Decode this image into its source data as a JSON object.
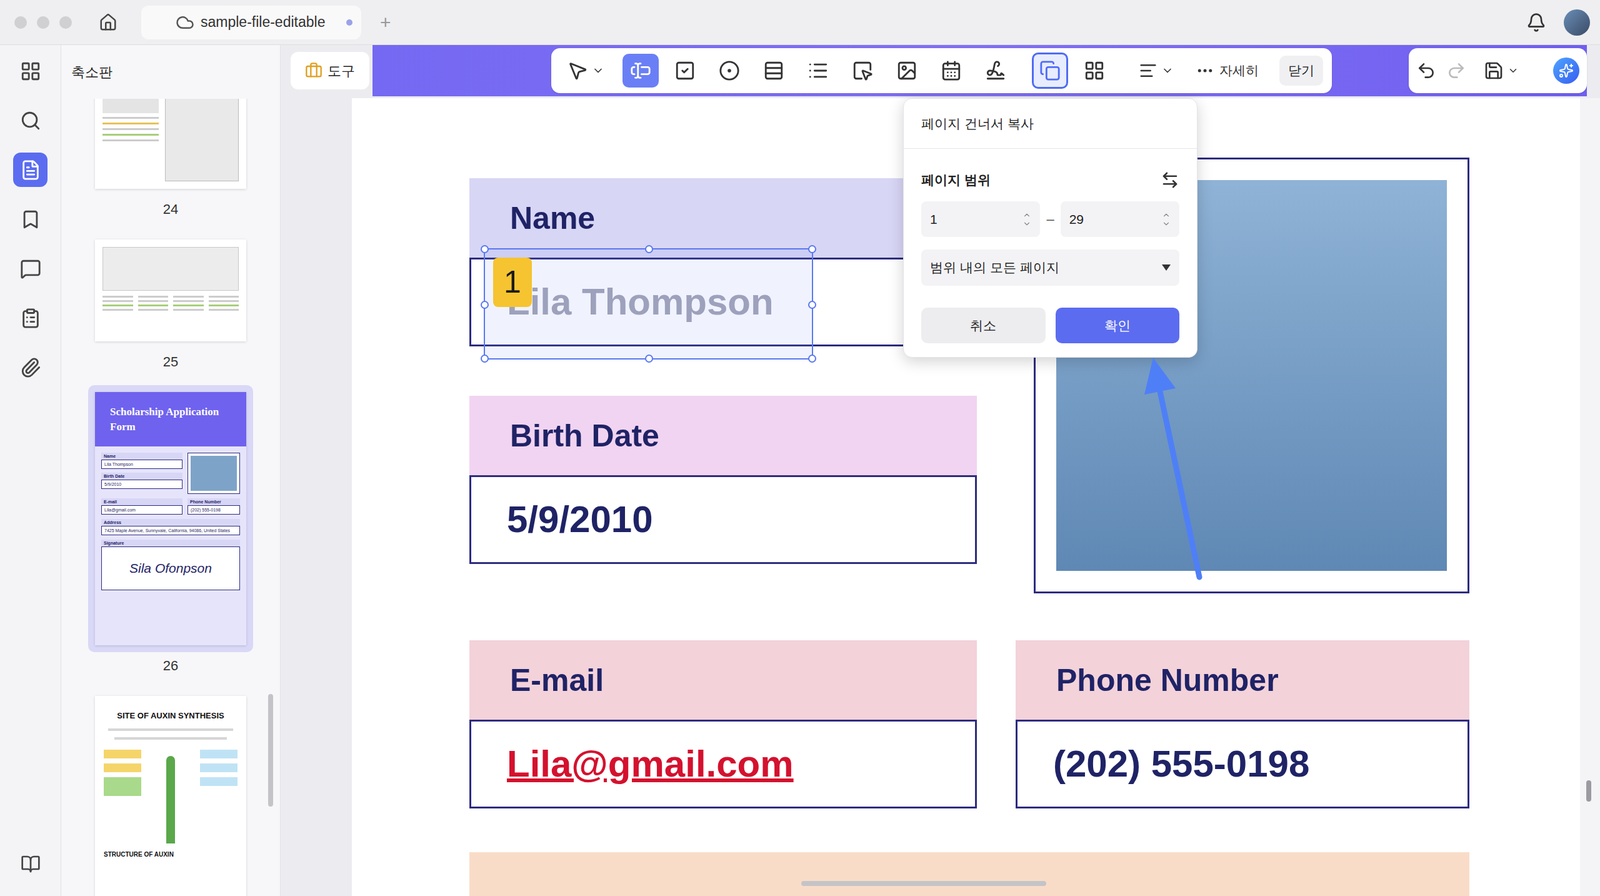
{
  "window": {
    "tab_title": "sample-file-editable",
    "tab_unsaved": true,
    "new_tab": "+"
  },
  "sidebar": {
    "items": [
      {
        "selected": false
      },
      {
        "selected": false
      },
      {
        "selected": true
      },
      {
        "selected": false
      },
      {
        "selected": false
      },
      {
        "selected": false
      },
      {
        "selected": false
      }
    ],
    "bottom_item": {
      "selected": false
    }
  },
  "thumbnails": {
    "title": "축소판",
    "pages": [
      {
        "label": "24",
        "selected": false,
        "kind": "drawing"
      },
      {
        "label": "25",
        "selected": false,
        "kind": "layout"
      },
      {
        "label": "26",
        "selected": true,
        "kind": "form",
        "title": "Scholarship Application Form",
        "fields": [
          {
            "label": "Name",
            "value": "Lila Thompson"
          },
          {
            "label": "Birth Date",
            "value": "5/9/2010"
          },
          {
            "label": "E-mail",
            "value": "Lila@gmail.com"
          },
          {
            "label": "Phone Number",
            "value": "(202) 555-0198"
          },
          {
            "label": "Address",
            "value": "7425 Maple Avenue, Sunnyvale, California, 94086, United States"
          }
        ],
        "signature_label": "Signature",
        "signature": "Sila Ofonpson"
      },
      {
        "selected": false,
        "kind": "diagram",
        "title": "SITE OF AUXIN SYNTHESIS",
        "subtitle": "STRUCTURE OF AUXIN"
      }
    ]
  },
  "toolbar": {
    "tools_button": "도구",
    "select": {
      "menu": true
    },
    "fields": [
      {
        "selected": true
      },
      {
        "selected": false
      },
      {
        "selected": false
      },
      {
        "selected": false
      },
      {
        "selected": false
      },
      {
        "selected": false
      },
      {
        "selected": false
      },
      {
        "selected": false
      },
      {
        "selected": false
      }
    ],
    "actions": [
      {
        "selected": false,
        "open": true
      },
      {
        "selected": false,
        "open": false
      }
    ],
    "align": {
      "menu": true
    },
    "more": "자세히",
    "close": "닫기"
  },
  "history": {
    "undo_enabled": true,
    "redo_enabled": false
  },
  "document": {
    "fields": [
      {
        "label": "Name",
        "value": "Lila Thompson",
        "header_color": "#d8d6f5",
        "value_color": "#a3a4b6",
        "underline": false,
        "selected": true,
        "badge": "1"
      },
      {
        "label": "Birth Date",
        "value": "5/9/2010",
        "header_color": "#f1d4f1",
        "value_color": "#1f2366",
        "underline": false,
        "selected": false
      },
      {
        "label": "E-mail",
        "value": "Lila@gmail.com",
        "header_color": "#f3d2da",
        "value_color": "#d4112e",
        "underline": true,
        "selected": false
      },
      {
        "label": "Phone Number",
        "value": "(202) 555-0198",
        "header_color": "#f3d2da",
        "value_color": "#1f2366",
        "underline": false,
        "selected": false
      }
    ]
  },
  "popup": {
    "title": "페이지 건너서 복사",
    "range_label": "페이지 범위",
    "from": "1",
    "to": "29",
    "separator": "–",
    "scope": "범위 내의 모든 페이지",
    "cancel": "취소",
    "confirm": "확인"
  }
}
